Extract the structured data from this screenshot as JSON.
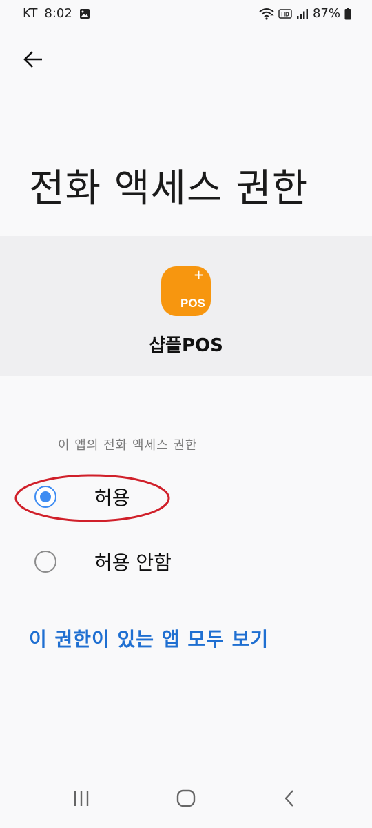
{
  "status_bar": {
    "carrier": "KT",
    "time": "8:02",
    "battery": "87%",
    "icons": [
      "image-icon",
      "wifi-icon",
      "hd-icon",
      "signal-icon",
      "battery-icon"
    ]
  },
  "header": {
    "back_icon": "back-arrow-icon",
    "title": "전화 액세스 권한"
  },
  "app": {
    "name": "샵플POS",
    "icon_text": "POS",
    "icon_plus": "+",
    "icon_color": "#f7960f"
  },
  "permission": {
    "section_label": "이 앱의 전화 액세스 권한",
    "options": [
      {
        "label": "허용",
        "selected": true
      },
      {
        "label": "허용 안함",
        "selected": false
      }
    ]
  },
  "link": {
    "label": "이 권한이 있는 앱 모두 보기",
    "color": "#1f6fd1"
  },
  "nav_bar": {
    "icons": [
      "recent-apps-icon",
      "home-icon",
      "back-icon"
    ]
  },
  "colors": {
    "accent": "#3e8cf2",
    "highlight": "#d0202a",
    "background": "#f9f9fa",
    "card_background": "#efeff1"
  }
}
